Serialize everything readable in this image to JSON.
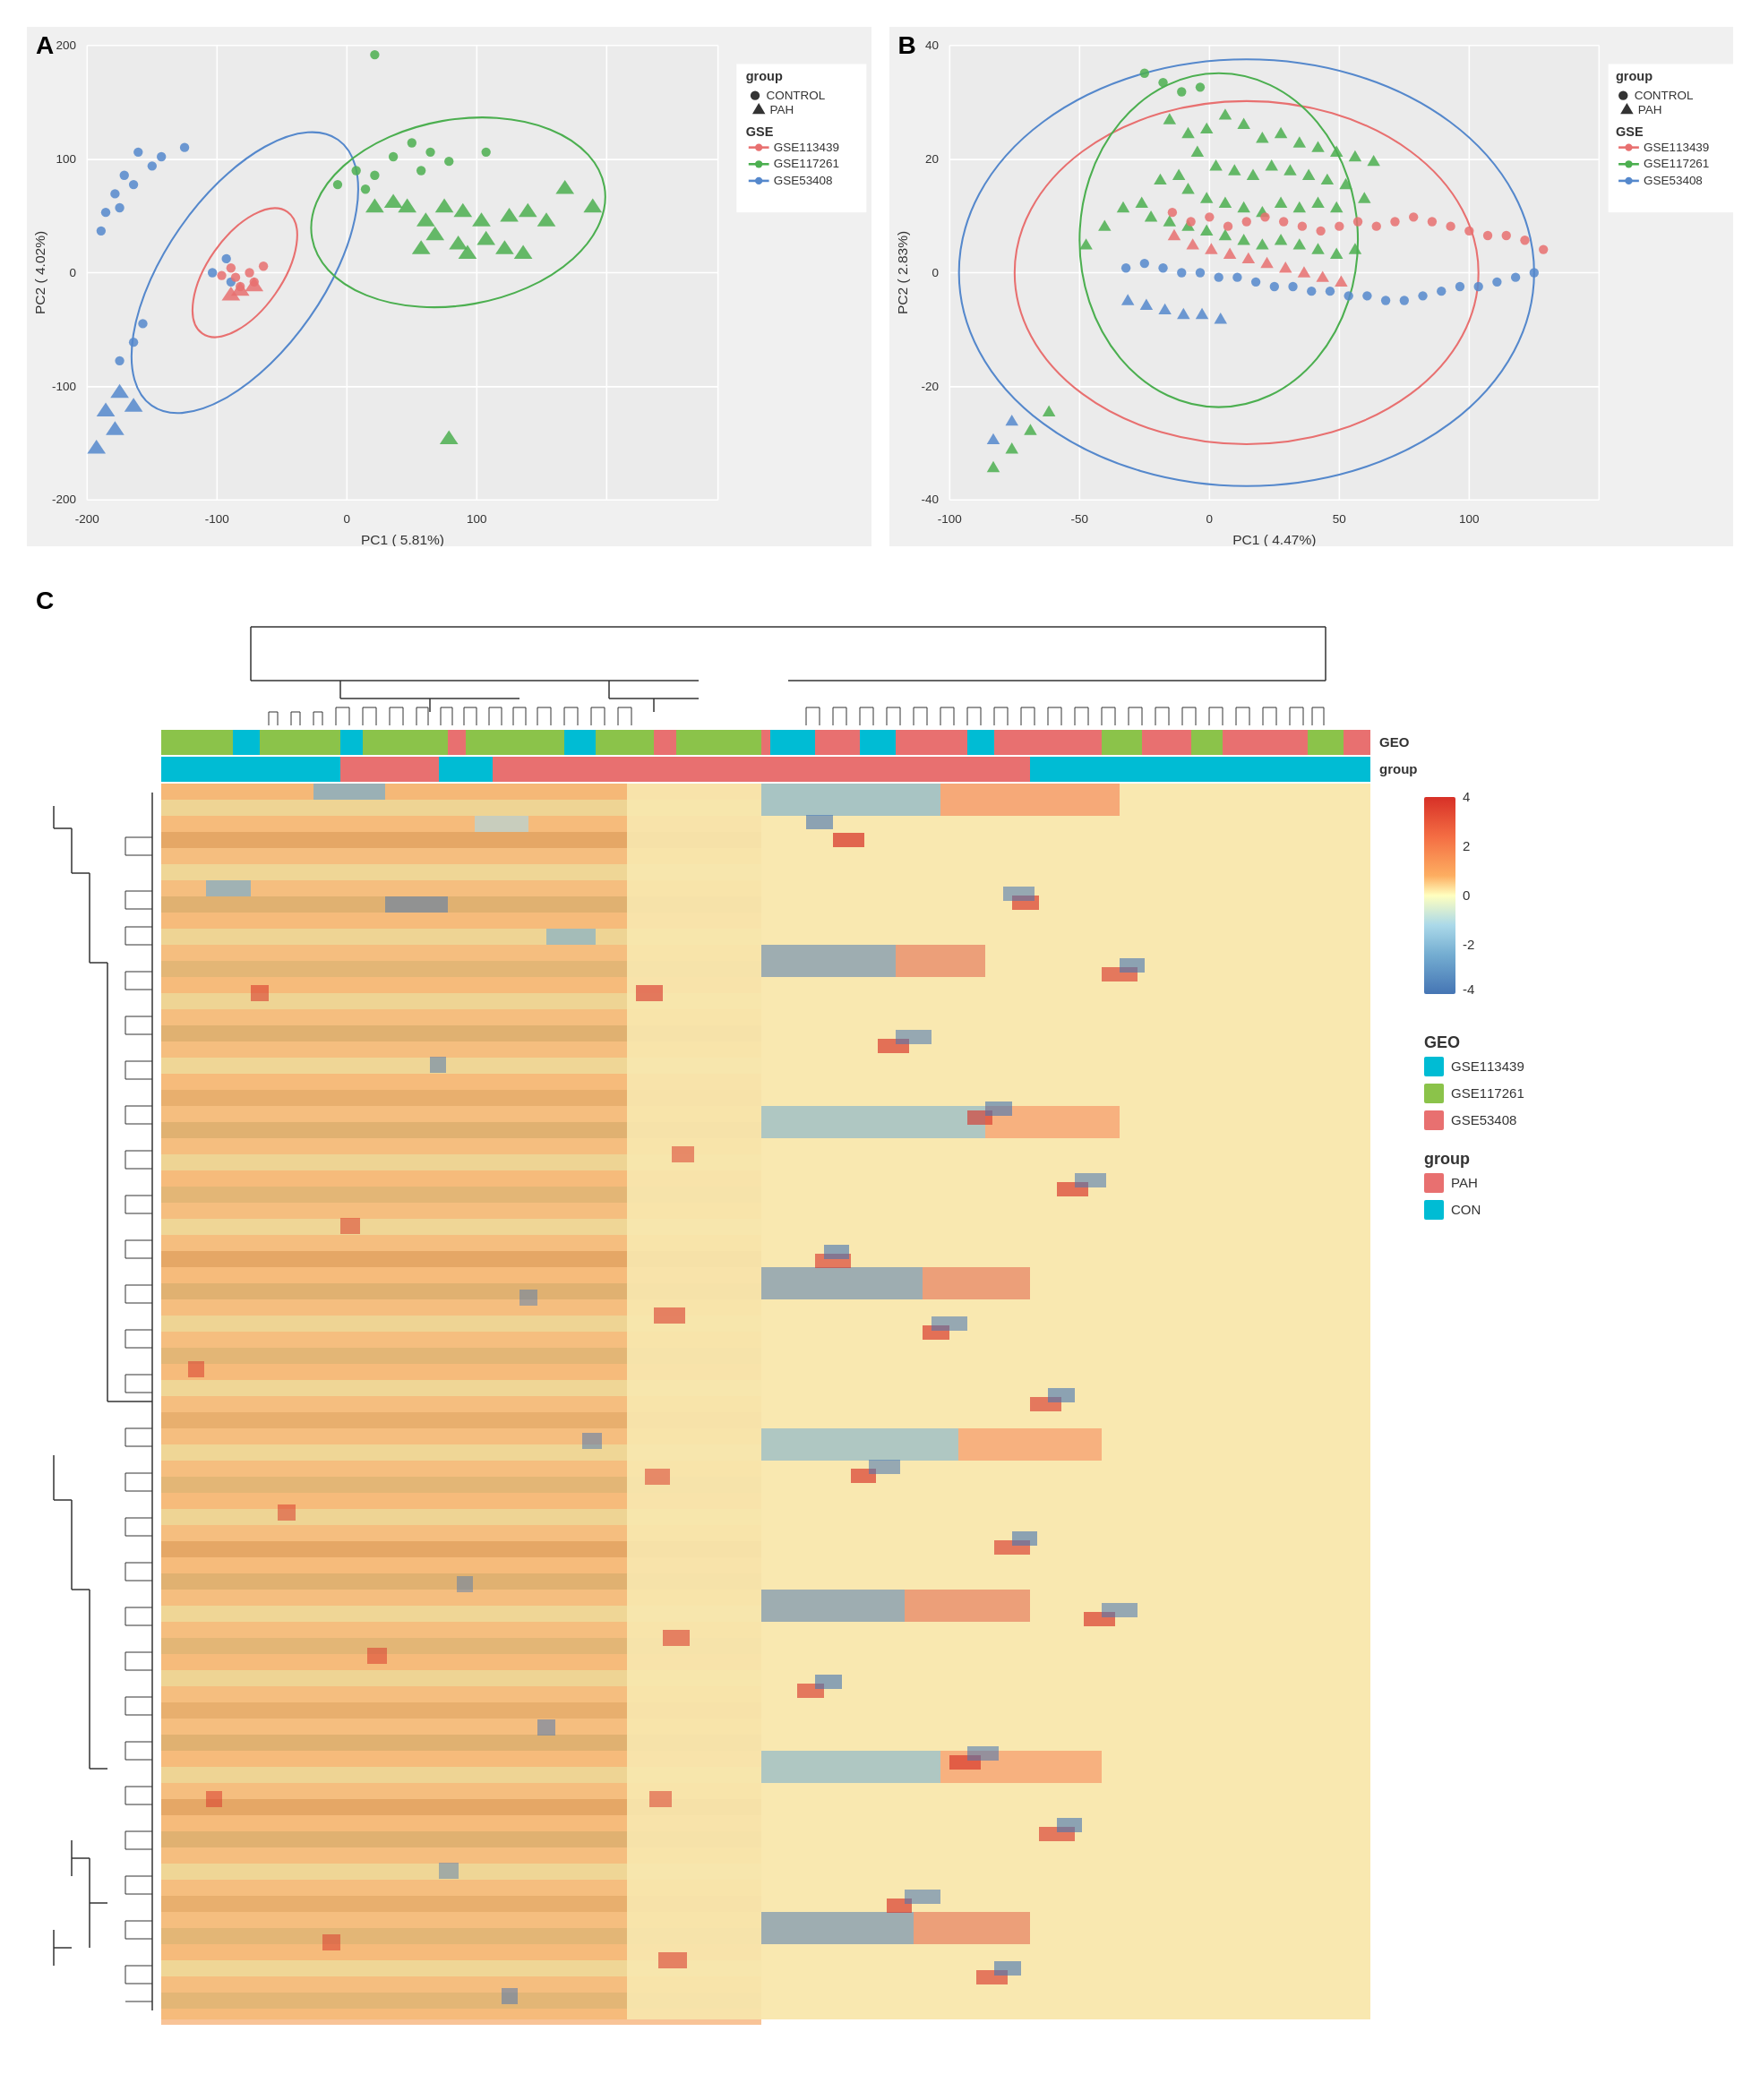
{
  "panels": {
    "A": {
      "label": "A",
      "xaxis": "PC1 ( 5.81%)",
      "yaxis": "PC2 ( 4.02%)",
      "legend_group_title": "group",
      "legend_group_items": [
        "CONTROL",
        "PAH"
      ],
      "legend_gse_title": "GSE",
      "legend_gse_items": [
        "GSE113439",
        "GSE117261",
        "GSE53408"
      ]
    },
    "B": {
      "label": "B",
      "xaxis": "PC1 ( 4.47%)",
      "yaxis": "PC2 ( 2.83%)",
      "legend_group_title": "group",
      "legend_group_items": [
        "CONTROL",
        "PAH"
      ],
      "legend_gse_title": "GSE",
      "legend_gse_items": [
        "GSE113439",
        "GSE117261",
        "GSE53408"
      ]
    },
    "C": {
      "label": "C",
      "geo_label": "GEO",
      "group_label": "group",
      "legend_geo_title": "GEO",
      "legend_geo_items": [
        "GSE113439",
        "GSE117261",
        "GSE53408"
      ],
      "legend_group_title": "group",
      "legend_group_items": [
        "PAH",
        "CON"
      ],
      "color_scale_values": [
        "4",
        "2",
        "0",
        "-2",
        "-4"
      ]
    }
  },
  "colors": {
    "gse113439": "#e87070",
    "gse117261": "#4caf50",
    "gse53408": "#5588cc",
    "control_dot": "#333333",
    "pah_triangle": "#333333",
    "ellipse_red": "#e87070",
    "ellipse_green": "#4caf50",
    "ellipse_blue": "#5588cc",
    "geo_gse113439": "#00bcd4",
    "geo_gse117261": "#8bc34a",
    "geo_gse53408": "#e87070",
    "group_pah": "#e87070",
    "group_con": "#00bcd4",
    "heatmap_high": "#d73027",
    "heatmap_mid": "#ffffbf",
    "heatmap_low": "#4575b4"
  }
}
